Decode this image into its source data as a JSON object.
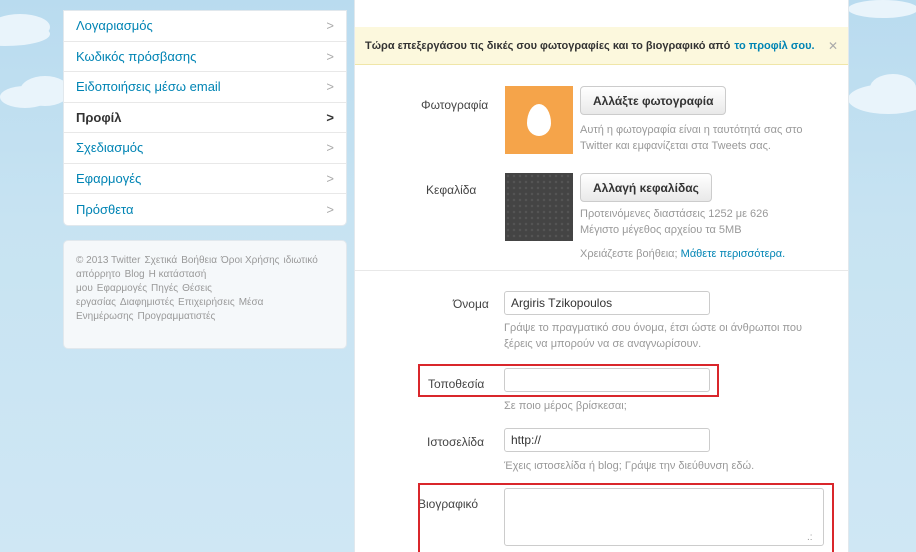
{
  "nav": {
    "items": [
      {
        "label": "Λογαριασμός"
      },
      {
        "label": "Κωδικός πρόσβασης"
      },
      {
        "label": "Ειδοποιήσεις μέσω email"
      },
      {
        "label": "Προφίλ"
      },
      {
        "label": "Σχεδιασμός"
      },
      {
        "label": "Εφαρμογές"
      },
      {
        "label": "Πρόσθετα"
      }
    ],
    "active": "Προφίλ"
  },
  "footer": {
    "links": [
      "© 2013 Twitter",
      "Σχετικά",
      "Βοήθεια",
      "Όροι Χρήσης",
      "ιδιωτικό απόρρητο",
      "Blog",
      "Η κατάστασή μου",
      "Εφαρμογές",
      "Πηγές",
      "Θέσεις εργασίας",
      "Διαφημιστές",
      "Επιχειρήσεις",
      "Μέσα Ενημέρωσης",
      "Προγραμματιστές"
    ]
  },
  "banner": {
    "text": "Τώρα επεξεργάσου τις δικές σου φωτογραφίες και το βιογραφικό από",
    "link": "το προφίλ σου."
  },
  "photo": {
    "label": "Φωτογραφία",
    "button": "Αλλάξτε φωτογραφία",
    "help_line1": "Αυτή η φωτογραφία είναι η ταυτότητά σας στο",
    "help_line2": "Twitter και εμφανίζεται στα Tweets σας."
  },
  "header": {
    "label": "Κεφαλίδα",
    "button": "Αλλαγή κεφαλίδας",
    "help_line1": "Προτεινόμενες διαστάσεις 1252 με 626",
    "help_line2": "Μέγιστο μέγεθος αρχείου τα 5MB",
    "help_question": "Χρειάζεστε βοήθεια;",
    "help_link": "Μάθετε περισσότερα."
  },
  "name": {
    "label": "Όνομα",
    "value": "Argiris Tzikopoulos",
    "help_line1": "Γράψε το πραγματικό σου όνομα, έτσι ώστε οι άνθρωποι που",
    "help_line2": "ξέρεις να μπορούν να σε αναγνωρίσουν."
  },
  "location": {
    "label": "Τοποθεσία",
    "value": "",
    "help": "Σε ποιο μέρος βρίσκεσαι;"
  },
  "website": {
    "label": "Ιστοσελίδα",
    "value": "http://",
    "help": "Έχεις ιστοσελίδα ή blog; Γράψε την διεύθυνση εδώ."
  },
  "bio": {
    "label": "Βιογραφικό",
    "value": ""
  },
  "icons": {
    "chevron": "chevron-right-icon",
    "close": "close-icon",
    "resize": "resize-handle-icon"
  },
  "colors": {
    "link": "#0084b4",
    "highlight": "#d9262b",
    "banner_bg": "#fcf8dd",
    "avatar_bg": "#f5a44a"
  }
}
